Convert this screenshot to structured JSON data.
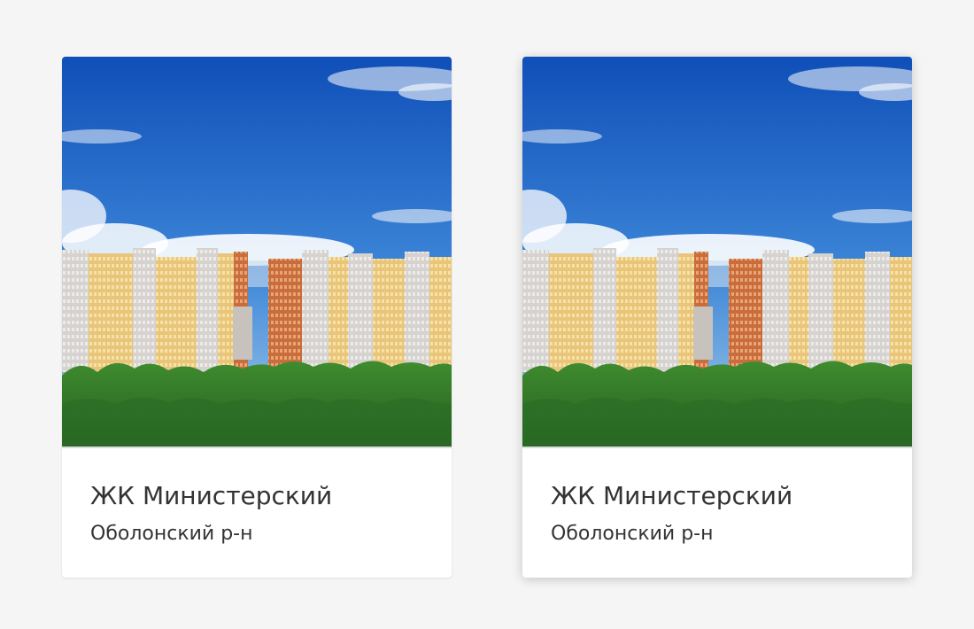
{
  "cards": [
    {
      "title": "ЖК Министерский",
      "subtitle": "Оболонский р-н",
      "image_icon": "residential-complex-photo"
    },
    {
      "title": "ЖК Министерский",
      "subtitle": "Оболонский р-н",
      "image_icon": "residential-complex-photo"
    }
  ],
  "colors": {
    "background": "#f5f5f5",
    "card": "#ffffff",
    "text": "#333333",
    "sky": "#1e64c8",
    "trees": "#2f7a2a"
  }
}
